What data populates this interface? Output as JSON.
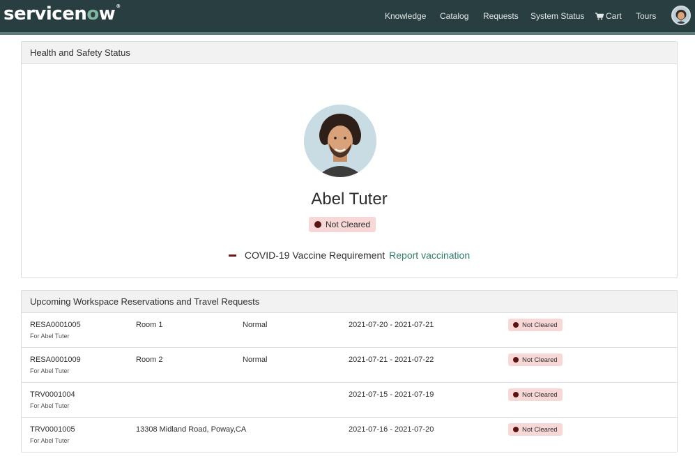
{
  "header": {
    "logo_text_a": "servicen",
    "logo_text_o": "o",
    "logo_text_b": "w",
    "logo_tm": "®",
    "nav": {
      "knowledge": "Knowledge",
      "catalog": "Catalog",
      "requests": "Requests",
      "system_status": "System Status",
      "cart": "Cart",
      "tours": "Tours"
    },
    "cart_icon": "cart-icon",
    "avatar_icon": "user-avatar-icon"
  },
  "health_safety": {
    "heading": "Health and Safety Status",
    "person_name": "Abel Tuter",
    "status": "Not Cleared",
    "requirement_label": "COVID-19 Vaccine Requirement",
    "requirement_link": "Report vaccination"
  },
  "reservations": {
    "heading": "Upcoming Workspace Reservations and Travel Requests",
    "rows": [
      {
        "id": "RESA0001005",
        "for": "For Abel Tuter",
        "location": "Room 1",
        "type": "Normal",
        "dates": "2021-07-20 - 2021-07-21",
        "status": "Not Cleared"
      },
      {
        "id": "RESA0001009",
        "for": "For Abel Tuter",
        "location": "Room 2",
        "type": "Normal",
        "dates": "2021-07-21 - 2021-07-22",
        "status": "Not Cleared"
      },
      {
        "id": "TRV0001004",
        "for": "For Abel Tuter",
        "location": "",
        "type": "",
        "dates": "2021-07-15 - 2021-07-19",
        "status": "Not Cleared"
      },
      {
        "id": "TRV0001005",
        "for": "For Abel Tuter",
        "location": "13308 Midland Road, Poway,CA",
        "type": "",
        "dates": "2021-07-16 - 2021-07-20",
        "status": "Not Cleared"
      }
    ]
  },
  "colors": {
    "header_bg": "#293e40",
    "accent_green": "#81b5a1",
    "link_green": "#2e7d6b",
    "not_cleared_bg": "#f8d7d7",
    "not_cleared_dot": "#5b1414"
  }
}
